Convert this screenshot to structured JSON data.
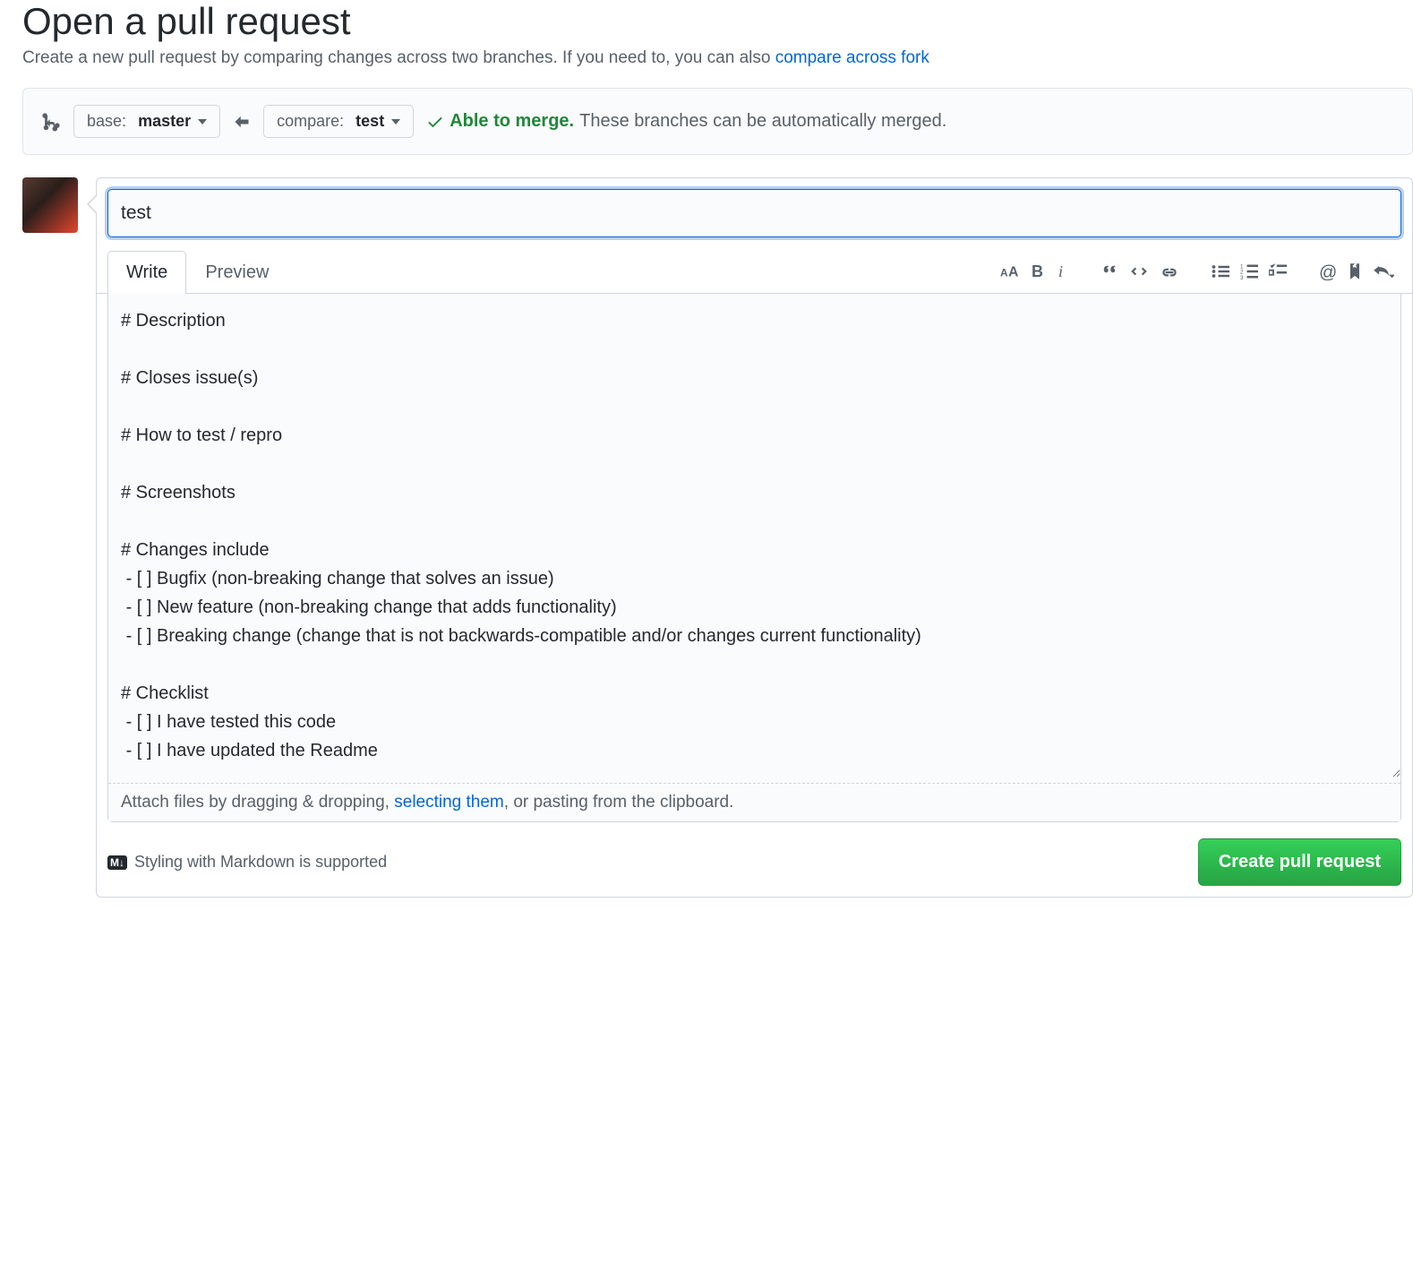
{
  "header": {
    "title": "Open a pull request",
    "subtitle_prefix": "Create a new pull request by comparing changes across two branches. If you need to, you can also ",
    "subtitle_link": "compare across fork"
  },
  "compare": {
    "base_label": "base:",
    "base_branch": "master",
    "compare_label": "compare:",
    "compare_branch": "test",
    "merge_status": "Able to merge.",
    "merge_description": "These branches can be automatically merged."
  },
  "form": {
    "title_value": "test",
    "tabs": {
      "write": "Write",
      "preview": "Preview"
    },
    "body": "# Description\n\n# Closes issue(s)\n\n# How to test / repro\n\n# Screenshots\n\n# Changes include\n - [ ] Bugfix (non-breaking change that solves an issue)\n - [ ] New feature (non-breaking change that adds functionality)\n - [ ] Breaking change (change that is not backwards-compatible and/or changes current functionality)\n\n# Checklist\n - [ ] I have tested this code\n - [ ] I have updated the Readme",
    "attach_prefix": "Attach files by dragging & dropping, ",
    "attach_link": "selecting them",
    "attach_suffix": ", or pasting from the clipboard.",
    "markdown_badge": "M↓",
    "markdown_hint": "Styling with Markdown is supported",
    "submit_label": "Create pull request"
  }
}
